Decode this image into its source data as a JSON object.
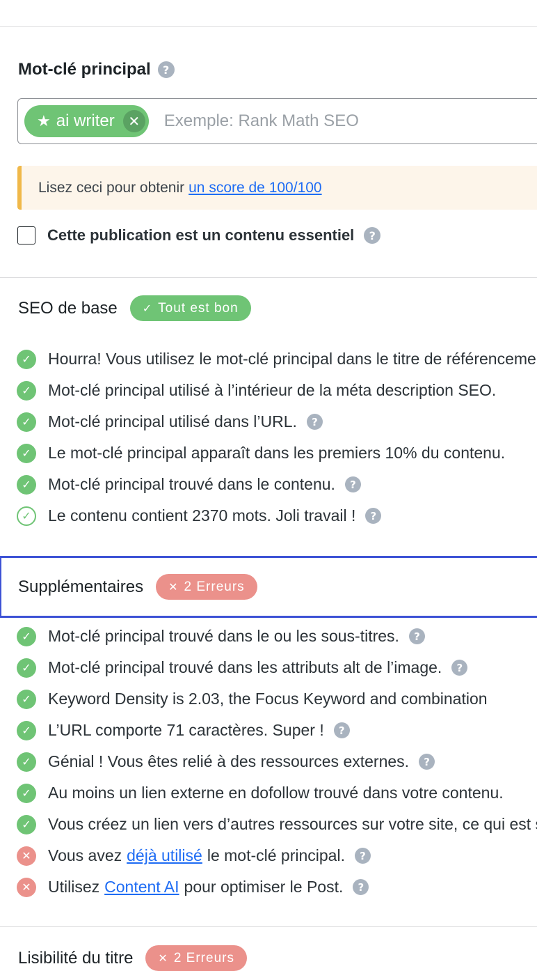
{
  "focus_keyword": {
    "label": "Mot-clé principal",
    "tag": "ai writer",
    "input_placeholder": "Exemple: Rank Math SEO"
  },
  "notice": {
    "text": "Lisez ceci pour obtenir",
    "link": "un score de 100/100"
  },
  "pillar_content": {
    "label": "Cette publication est un contenu essentiel",
    "checked": false
  },
  "icons": {
    "help": "?",
    "check": "✓",
    "cross": "✕",
    "star": "★"
  },
  "colors": {
    "success": "#6fc475",
    "error": "#eb918b",
    "link": "#1e6cf4",
    "focus_border": "#3d52d5",
    "notice_border": "#f0b849"
  },
  "sections": {
    "basic_seo": {
      "title": "SEO de base",
      "badge": "Tout est bon",
      "items": [
        {
          "status": "ok",
          "text": "Hourra!  Vous utilisez le mot-clé principal dans le titre de référencement."
        },
        {
          "status": "ok",
          "text": "Mot-clé principal utilisé à l’intérieur de la méta description SEO."
        },
        {
          "status": "ok",
          "text": "Mot-clé principal utilisé dans l’URL."
        },
        {
          "status": "ok",
          "text": "Le mot-clé principal apparaît dans les premiers 10% du contenu."
        },
        {
          "status": "ok",
          "text": "Mot-clé principal trouvé dans le contenu."
        },
        {
          "status": "ok-outline",
          "text": "Le contenu contient 2370 mots. Joli travail !"
        }
      ]
    },
    "additional": {
      "title": "Supplémentaires",
      "badge": "2 Erreurs",
      "items": [
        {
          "status": "ok",
          "text": "Mot-clé principal trouvé dans le ou les sous-titres."
        },
        {
          "status": "ok",
          "text": "Mot-clé principal trouvé dans les attributs alt de l’image."
        },
        {
          "status": "ok",
          "text": "Keyword Density is 2.03, the Focus Keyword and combination"
        },
        {
          "status": "ok",
          "text": "L’URL comporte 71 caractères. Super !"
        },
        {
          "status": "ok",
          "text": "Génial ! Vous êtes relié à des ressources externes."
        },
        {
          "status": "ok",
          "text": "Au moins un lien externe en dofollow trouvé dans votre contenu."
        },
        {
          "status": "ok",
          "text": "Vous créez un lien vers d’autres ressources sur votre site, ce qui est super."
        },
        {
          "status": "err",
          "before": "Vous avez",
          "link": "déjà utilisé",
          "after": "le mot-clé principal."
        },
        {
          "status": "err",
          "before": "Utilisez",
          "link": "Content AI",
          "after": "pour optimiser le Post."
        }
      ]
    },
    "title_readability": {
      "title": "Lisibilité du titre",
      "badge": "2 Erreurs"
    }
  }
}
